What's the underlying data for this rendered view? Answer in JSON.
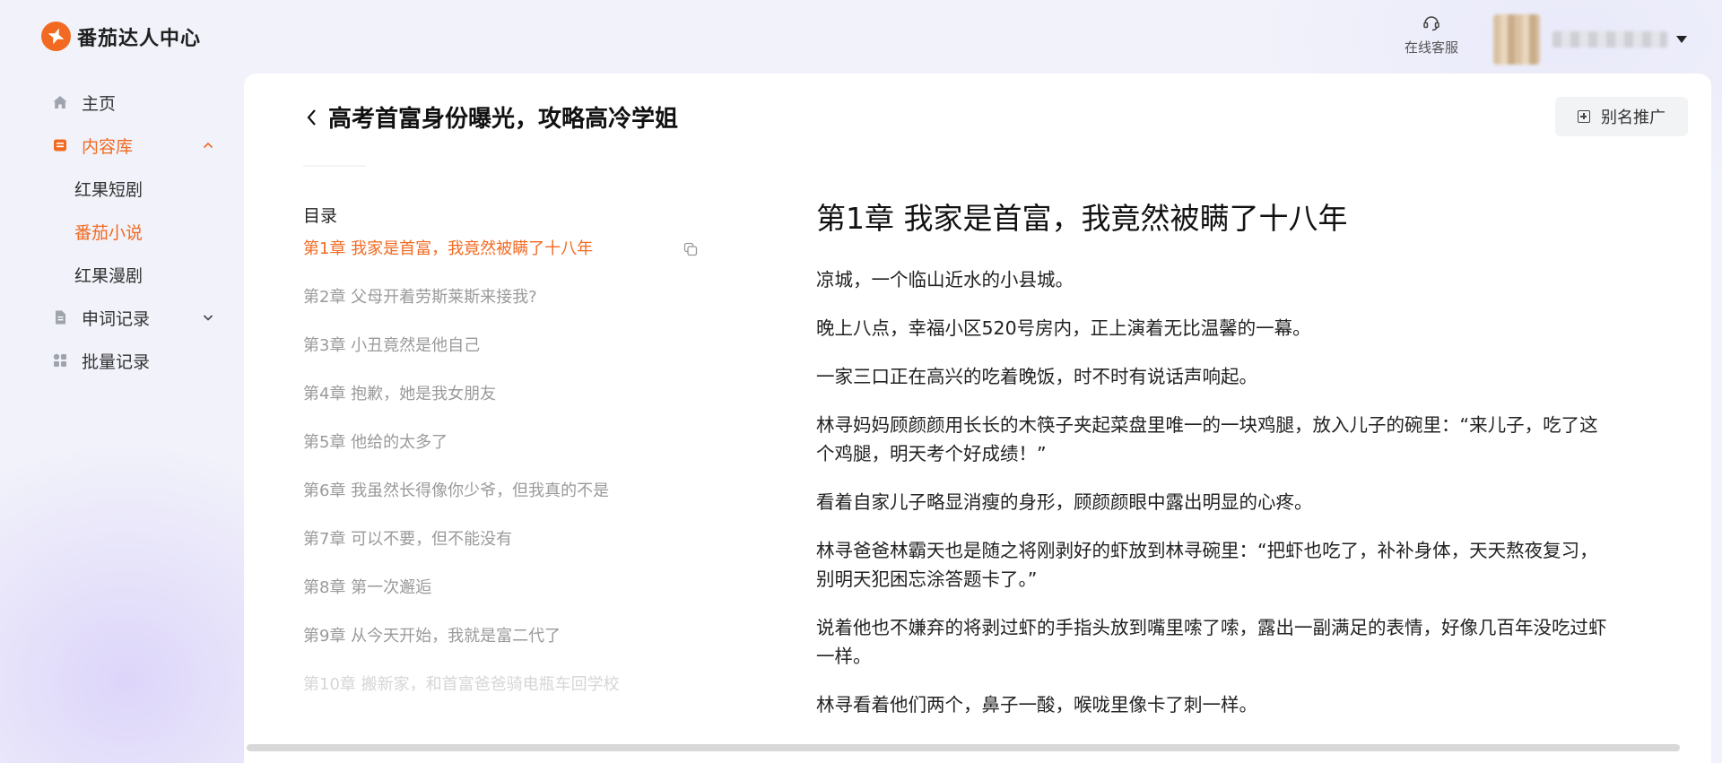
{
  "app": {
    "title": "番茄达人中心"
  },
  "sidebar": {
    "items": [
      {
        "label": "主页",
        "icon": "home-icon"
      },
      {
        "label": "内容库",
        "icon": "content-library-icon",
        "active": true,
        "expanded": true,
        "children": [
          {
            "label": "红果短剧"
          },
          {
            "label": "番茄小说",
            "active": true
          },
          {
            "label": "红果漫剧"
          }
        ]
      },
      {
        "label": "申词记录",
        "icon": "document-icon",
        "expanded": false
      },
      {
        "label": "批量记录",
        "icon": "batch-icon"
      }
    ]
  },
  "header": {
    "support_label": "在线客服"
  },
  "book": {
    "title": "高考首富身份曝光，攻略高冷学姐",
    "alias_button": "别名推广"
  },
  "toc": {
    "heading": "目录",
    "chapters": [
      "第1章 我家是首富，我竟然被瞒了十八年",
      "第2章 父母开着劳斯莱斯来接我?",
      "第3章 小丑竟然是他自己",
      "第4章 抱歉，她是我女朋友",
      "第5章 他给的太多了",
      "第6章 我虽然长得像你少爷，但我真的不是",
      "第7章 可以不要，但不能没有",
      "第8章 第一次邂逅",
      "第9章 从今天开始，我就是富二代了",
      "第10章 搬新家，和首富爸爸骑电瓶车回学校"
    ]
  },
  "reader": {
    "chapter_title": "第1章 我家是首富，我竟然被瞒了十八年",
    "paragraphs": [
      "凉城，一个临山近水的小县城。",
      "晚上八点，幸福小区520号房内，正上演着无比温馨的一幕。",
      "一家三口正在高兴的吃着晚饭，时不时有说话声响起。",
      "林寻妈妈顾颜颜用长长的木筷子夹起菜盘里唯一的一块鸡腿，放入儿子的碗里：“来儿子，吃了这个鸡腿，明天考个好成绩！”",
      "看着自家儿子略显消瘦的身形，顾颜颜眼中露出明显的心疼。",
      "林寻爸爸林霸天也是随之将刚剥好的虾放到林寻碗里：“把虾也吃了，补补身体，天天熬夜复习，别明天犯困忘涂答题卡了。”",
      "说着他也不嫌弃的将剥过虾的手指头放到嘴里嗦了嗦，露出一副满足的表情，好像几百年没吃过虾一样。",
      "林寻看着他们两个，鼻子一酸，喉咙里像卡了刺一样。"
    ]
  },
  "colors": {
    "accent": "#f26a21",
    "background": "#f1f2fa"
  }
}
